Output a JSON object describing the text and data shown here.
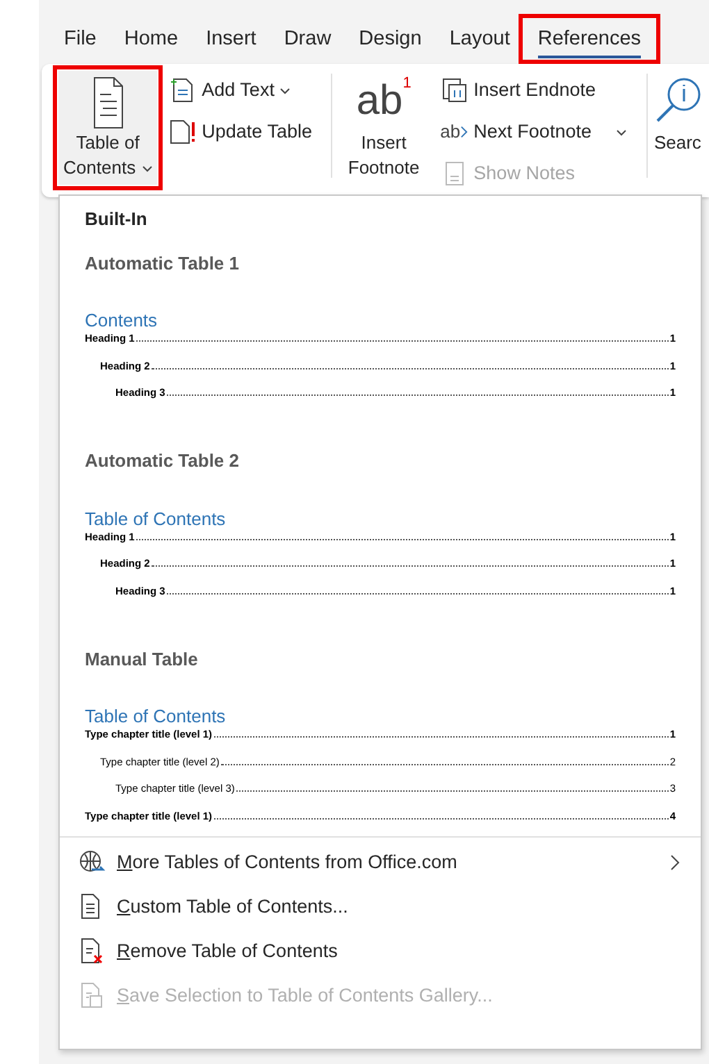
{
  "tabs": [
    {
      "label": "File",
      "selected": false,
      "highlighted": false
    },
    {
      "label": "Home",
      "selected": false,
      "highlighted": false
    },
    {
      "label": "Insert",
      "selected": false,
      "highlighted": false
    },
    {
      "label": "Draw",
      "selected": false,
      "highlighted": false
    },
    {
      "label": "Design",
      "selected": false,
      "highlighted": false
    },
    {
      "label": "Layout",
      "selected": false,
      "highlighted": false
    },
    {
      "label": "References",
      "selected": true,
      "highlighted": true
    }
  ],
  "ribbon": {
    "toc_button": {
      "label_line1": "Table of",
      "label_line2": "Contents",
      "highlighted": true
    },
    "toc_small": [
      {
        "label": "Add Text",
        "dropdown": true,
        "kind": "add-text"
      },
      {
        "label": "Update Table",
        "dropdown": false,
        "kind": "update"
      }
    ],
    "footnote_button": {
      "icon_text": "ab",
      "icon_mark": "1",
      "label_line1": "Insert",
      "label_line2": "Footnote"
    },
    "footnote_small": [
      {
        "label": "Insert Endnote",
        "disabled": false,
        "dropdown": false,
        "kind": "endnote"
      },
      {
        "label": "Next Footnote",
        "disabled": false,
        "dropdown": true,
        "kind": "next",
        "icon_text": "ab"
      },
      {
        "label": "Show Notes",
        "disabled": true,
        "dropdown": false,
        "kind": "notes"
      }
    ],
    "search_button": {
      "label": "Searc"
    }
  },
  "menu": {
    "section_title": "Built-In",
    "gallery": [
      {
        "name": "Automatic Table 1",
        "toc_title": "Contents",
        "entries": [
          {
            "text": "Heading 1",
            "page": "1",
            "bold": true,
            "children": [
              {
                "text": "Heading 2",
                "page": "1",
                "bold": true,
                "children": [
                  {
                    "text": "Heading 3",
                    "page": "1",
                    "bold": true
                  }
                ]
              }
            ]
          }
        ]
      },
      {
        "name": "Automatic Table 2",
        "toc_title": "Table of Contents",
        "entries": [
          {
            "text": "Heading 1",
            "page": "1",
            "bold": true,
            "children": [
              {
                "text": "Heading 2",
                "page": "1",
                "bold": true,
                "children": [
                  {
                    "text": "Heading 3",
                    "page": "1",
                    "bold": true
                  }
                ]
              }
            ]
          }
        ]
      },
      {
        "name": "Manual Table",
        "toc_title": "Table of Contents",
        "entries": [
          {
            "text": "Type chapter title (level 1)",
            "page": "1",
            "bold": true,
            "children": [
              {
                "text": "Type chapter title (level 2)",
                "page": "2",
                "bold": false,
                "children": [
                  {
                    "text": "Type chapter title (level 3)",
                    "page": "3",
                    "bold": false
                  }
                ]
              }
            ]
          },
          {
            "text": "Type chapter title (level 1)",
            "page": "4",
            "bold": true
          }
        ]
      }
    ],
    "commands": [
      {
        "access_key": "M",
        "label_rest": "ore Tables of Contents from Office.com",
        "kind": "globe",
        "submenu": true,
        "disabled": false
      },
      {
        "access_key": "C",
        "label_rest": "ustom Table of Contents...",
        "kind": "custom",
        "submenu": false,
        "disabled": false
      },
      {
        "access_key": "R",
        "label_rest": "emove Table of Contents",
        "kind": "remove",
        "submenu": false,
        "disabled": false
      },
      {
        "access_key": "S",
        "label_rest": "ave Selection to Table of Contents Gallery...",
        "kind": "save",
        "submenu": false,
        "disabled": true
      }
    ]
  }
}
